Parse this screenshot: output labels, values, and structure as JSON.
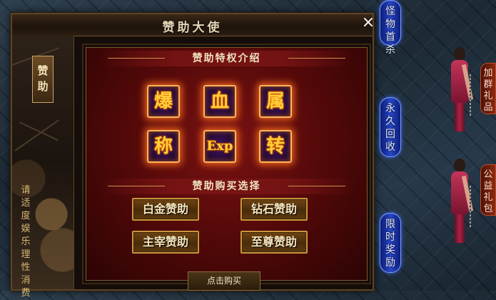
{
  "dialog": {
    "title": "赞助大使",
    "close_glyph": "×",
    "sidebar_tab": [
      "赞",
      "助"
    ],
    "sidebar_text": [
      "请",
      "适",
      "度",
      "娱",
      "乐",
      "理",
      "性",
      "消",
      "费"
    ]
  },
  "privileges": {
    "header": "赞助特权介绍",
    "icons": [
      "爆",
      "血",
      "属",
      "称",
      "Exp",
      "转"
    ]
  },
  "purchase": {
    "header": "赞助购买选择",
    "options": [
      "白金赞助",
      "钻石赞助",
      "主宰赞助",
      "至尊赞助"
    ],
    "confirm_label": "点击购买"
  },
  "game_side": {
    "blue_buttons": [
      [
        "怪",
        "物",
        "首",
        "杀"
      ],
      [
        "永",
        "久",
        "回",
        "收"
      ],
      [
        "限",
        "时",
        "奖",
        "励"
      ]
    ],
    "red_buttons": [
      [
        "加",
        "群",
        "礼",
        "品"
      ],
      [
        "公",
        "益",
        "礼",
        "包"
      ]
    ]
  },
  "colors": {
    "accent_gold": "#ffcf3a",
    "panel_red": "#7a1212",
    "button_blue": "#2a48c9"
  }
}
